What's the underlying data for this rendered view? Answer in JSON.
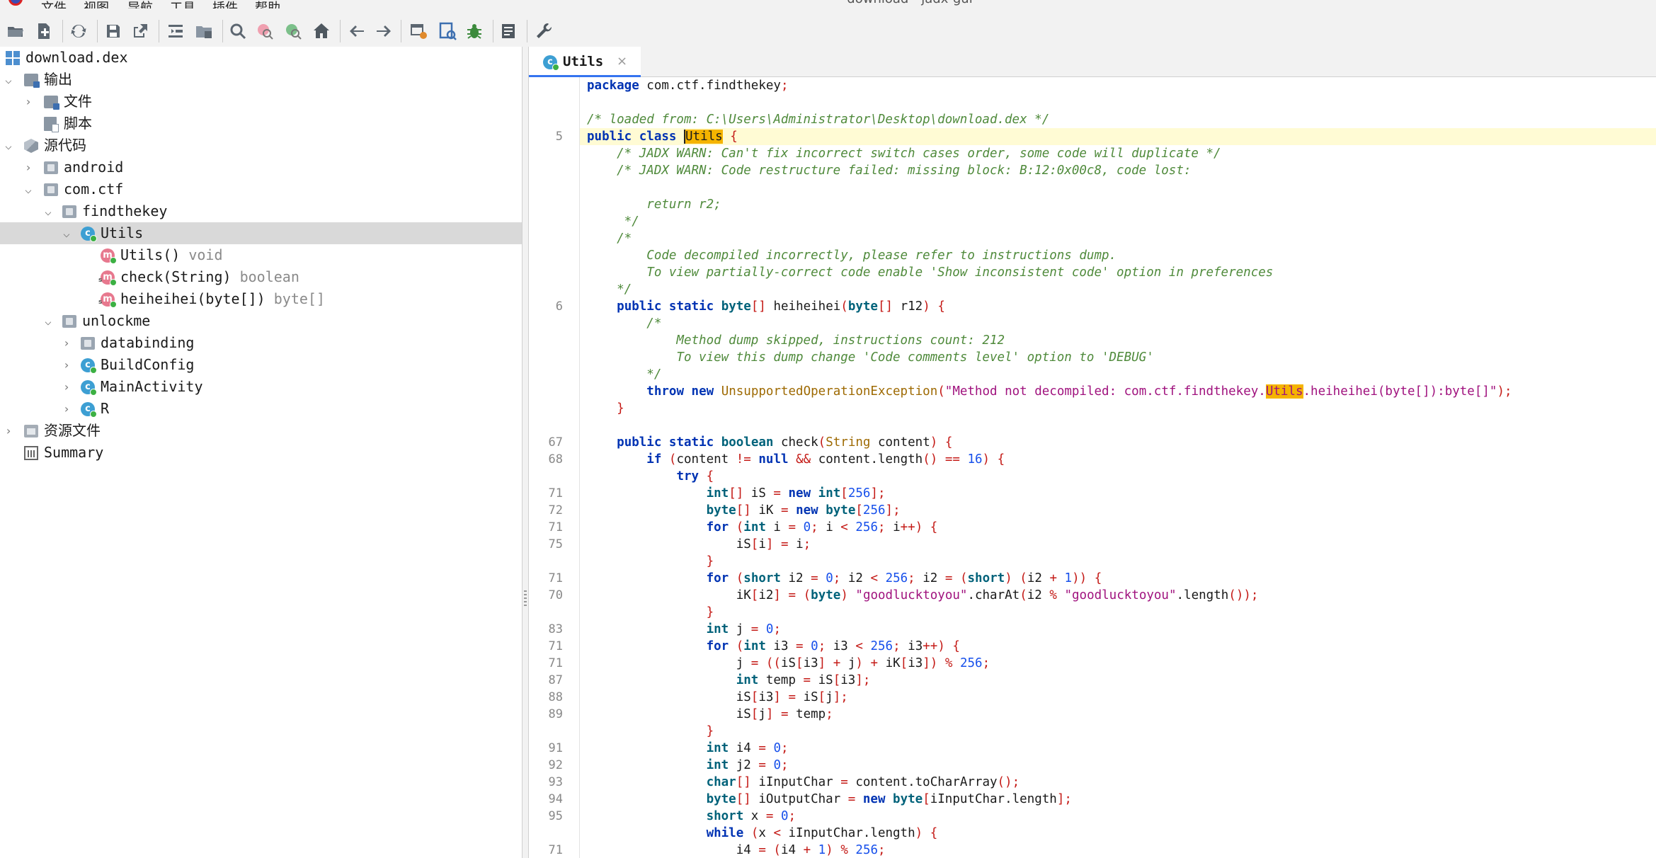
{
  "window": {
    "title": "download - jadx-gui",
    "menu": [
      "文件",
      "视图",
      "导航",
      "工具",
      "插件",
      "帮助"
    ]
  },
  "toolbar": {
    "buttons": [
      "open-file-icon",
      "add-files-icon",
      "sync-icon",
      "save-all-icon",
      "export-icon",
      "expand-icon",
      "flat-packages-icon",
      "search-icon",
      "find-class-icon",
      "find-usage-icon",
      "home-icon",
      "back-icon",
      "forward-icon",
      "deobfuscation-icon",
      "quick-tabs-icon",
      "debug-icon",
      "log-viewer-icon",
      "preferences-icon"
    ]
  },
  "tree": {
    "rows": [
      {
        "label": "download.dex",
        "sub": ""
      },
      {
        "label": "输出",
        "sub": ""
      },
      {
        "label": "文件",
        "sub": ""
      },
      {
        "label": "脚本",
        "sub": ""
      },
      {
        "label": "源代码",
        "sub": ""
      },
      {
        "label": "android",
        "sub": ""
      },
      {
        "label": "com.ctf",
        "sub": ""
      },
      {
        "label": "findthekey",
        "sub": ""
      },
      {
        "label": "Utils",
        "sub": ""
      },
      {
        "label": "Utils()",
        "sub": "void"
      },
      {
        "label": "check(String)",
        "sub": "boolean"
      },
      {
        "label": "heiheihei(byte[])",
        "sub": "byte[]"
      },
      {
        "label": "unlockme",
        "sub": ""
      },
      {
        "label": "databinding",
        "sub": ""
      },
      {
        "label": "BuildConfig",
        "sub": ""
      },
      {
        "label": "MainActivity",
        "sub": ""
      },
      {
        "label": "R",
        "sub": ""
      },
      {
        "label": "资源文件",
        "sub": ""
      },
      {
        "label": "Summary",
        "sub": ""
      }
    ]
  },
  "editor": {
    "tab_label": "Utils",
    "tab_close": "×",
    "lines": [
      {
        "ln": "",
        "text": "package com.ctf.findthekey;"
      },
      {
        "ln": "",
        "text": ""
      },
      {
        "ln": "",
        "text": "/* loaded from: C:\\Users\\Administrator\\Desktop\\download.dex */"
      },
      {
        "ln": "5",
        "text": "public class Utils {"
      },
      {
        "ln": "",
        "text": "    /* JADX WARN: Can't fix incorrect switch cases order, some code will duplicate */"
      },
      {
        "ln": "",
        "text": "    /* JADX WARN: Code restructure failed: missing block: B:12:0x00c8, code lost:"
      },
      {
        "ln": "",
        "text": ""
      },
      {
        "ln": "",
        "text": "        return r2;"
      },
      {
        "ln": "",
        "text": "     */"
      },
      {
        "ln": "",
        "text": "    /*"
      },
      {
        "ln": "",
        "text": "        Code decompiled incorrectly, please refer to instructions dump."
      },
      {
        "ln": "",
        "text": "        To view partially-correct code enable 'Show inconsistent code' option in preferences"
      },
      {
        "ln": "",
        "text": "    */"
      },
      {
        "ln": "6",
        "text": "    public static byte[] heiheihei(byte[] r12) {"
      },
      {
        "ln": "",
        "text": "        /*"
      },
      {
        "ln": "",
        "text": "            Method dump skipped, instructions count: 212"
      },
      {
        "ln": "",
        "text": "            To view this dump change 'Code comments level' option to 'DEBUG'"
      },
      {
        "ln": "",
        "text": "        */"
      },
      {
        "ln": "",
        "text": "        throw new UnsupportedOperationException(\"Method not decompiled: com.ctf.findthekey.Utils.heiheihei(byte[]):byte[]\");"
      },
      {
        "ln": "",
        "text": "    }"
      },
      {
        "ln": "",
        "text": ""
      },
      {
        "ln": "67",
        "text": "    public static boolean check(String content) {"
      },
      {
        "ln": "68",
        "text": "        if (content != null && content.length() == 16) {"
      },
      {
        "ln": "",
        "text": "            try {"
      },
      {
        "ln": "71",
        "text": "                int[] iS = new int[256];"
      },
      {
        "ln": "72",
        "text": "                byte[] iK = new byte[256];"
      },
      {
        "ln": "71",
        "text": "                for (int i = 0; i < 256; i++) {"
      },
      {
        "ln": "75",
        "text": "                    iS[i] = i;"
      },
      {
        "ln": "",
        "text": "                }"
      },
      {
        "ln": "71",
        "text": "                for (short i2 = 0; i2 < 256; i2 = (short) (i2 + 1)) {"
      },
      {
        "ln": "70",
        "text": "                    iK[i2] = (byte) \"goodlucktoyou\".charAt(i2 % \"goodlucktoyou\".length());"
      },
      {
        "ln": "",
        "text": "                }"
      },
      {
        "ln": "83",
        "text": "                int j = 0;"
      },
      {
        "ln": "71",
        "text": "                for (int i3 = 0; i3 < 256; i3++) {"
      },
      {
        "ln": "71",
        "text": "                    j = ((iS[i3] + j) + iK[i3]) % 256;"
      },
      {
        "ln": "87",
        "text": "                    int temp = iS[i3];"
      },
      {
        "ln": "88",
        "text": "                    iS[i3] = iS[j];"
      },
      {
        "ln": "89",
        "text": "                    iS[j] = temp;"
      },
      {
        "ln": "",
        "text": "                }"
      },
      {
        "ln": "91",
        "text": "                int i4 = 0;"
      },
      {
        "ln": "92",
        "text": "                int j2 = 0;"
      },
      {
        "ln": "93",
        "text": "                char[] iInputChar = content.toCharArray();"
      },
      {
        "ln": "94",
        "text": "                byte[] iOutputChar = new byte[iInputChar.length];"
      },
      {
        "ln": "95",
        "text": "                short x = 0;"
      },
      {
        "ln": "",
        "text": "                while (x < iInputChar.length) {"
      },
      {
        "ln": "71",
        "text": "                    i4 = (i4 + 1) % 256;"
      }
    ]
  },
  "colors": {
    "keyword": "#0033b3",
    "comment": "#4f8a3b",
    "string": "#a0127e",
    "number": "#1750eb",
    "search_hit": "#f5b400",
    "current_line": "#fffbd4",
    "selection": "#d9d9d9"
  }
}
